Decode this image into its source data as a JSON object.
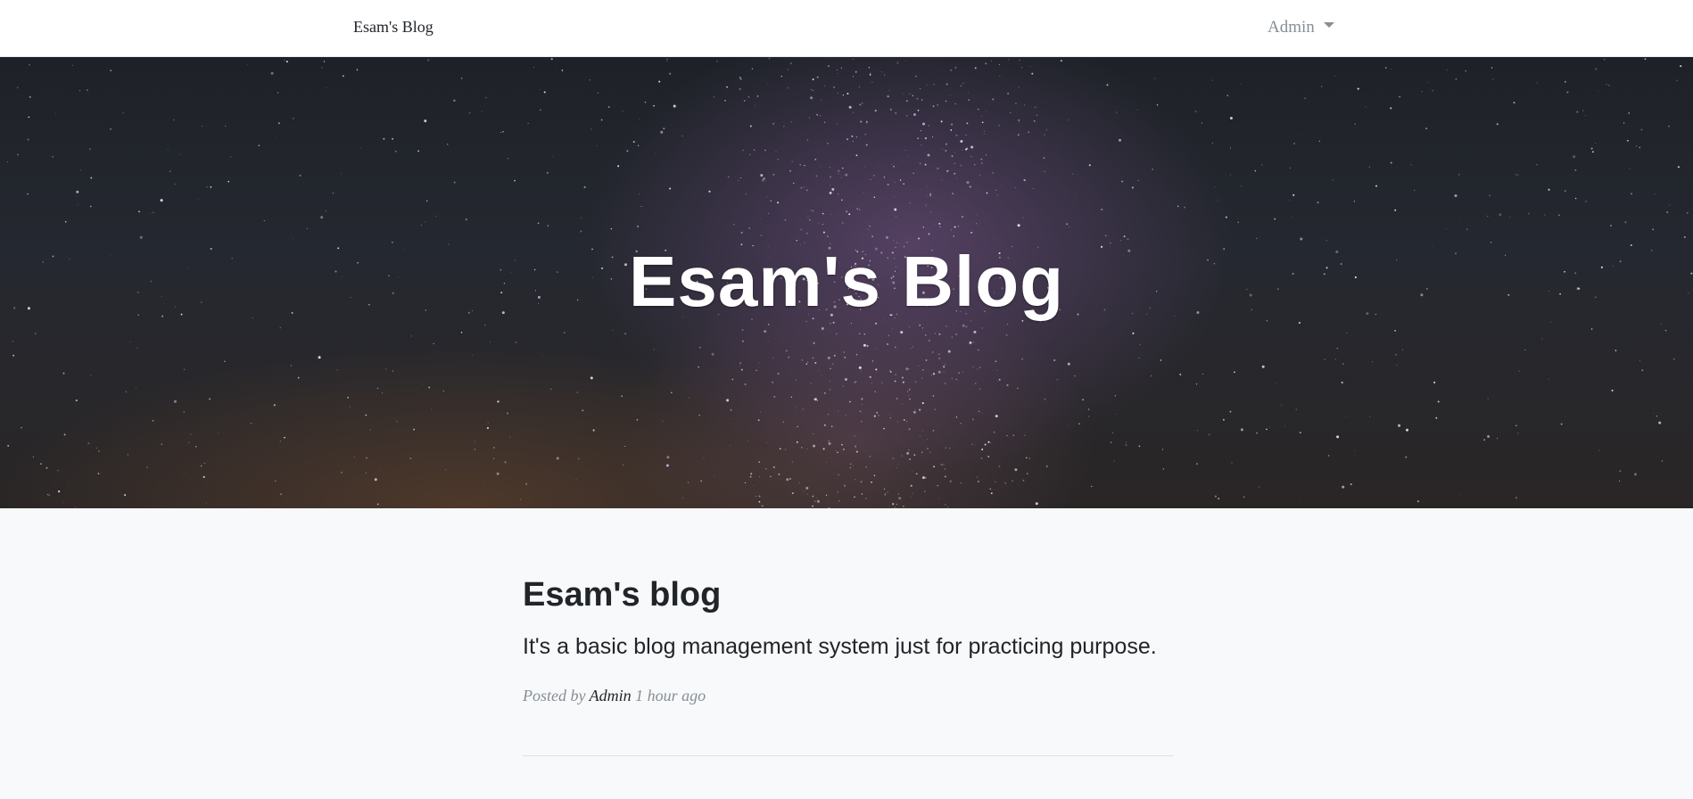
{
  "navbar": {
    "brand": "Esam's Blog",
    "user_menu_label": "Admin",
    "user_menu_icon": "caret-down-icon"
  },
  "hero": {
    "title": "Esam's Blog",
    "background": "starry-night-sky-image"
  },
  "posts": [
    {
      "title": "Esam's blog",
      "subtitle": "It's a basic blog management system just for practicing purpose.",
      "meta_prefix": "Posted by",
      "author": "Admin",
      "time": "1 hour ago"
    }
  ],
  "colors": {
    "text_dark": "#212529",
    "text_muted": "#868e96",
    "page_bg": "#f8f9fa",
    "navbar_bg": "#ffffff"
  }
}
